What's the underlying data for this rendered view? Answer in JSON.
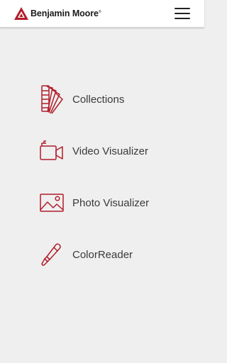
{
  "header": {
    "brand_name": "Benjamin Moore",
    "brand_mark": "®",
    "logo_icon": "benjamin-moore-triangle-logo",
    "menu_icon": "hamburger-menu-icon"
  },
  "menu": {
    "items": [
      {
        "label": "Collections",
        "icon": "color-fan-deck-icon"
      },
      {
        "label": "Video Visualizer",
        "icon": "video-camera-icon"
      },
      {
        "label": "Photo Visualizer",
        "icon": "photo-landscape-icon"
      },
      {
        "label": "ColorReader",
        "icon": "color-pen-icon"
      }
    ]
  },
  "colors": {
    "accent": "#b11c2a",
    "background": "#efefef",
    "header_bg": "#ffffff",
    "text": "#3a3a3a"
  }
}
